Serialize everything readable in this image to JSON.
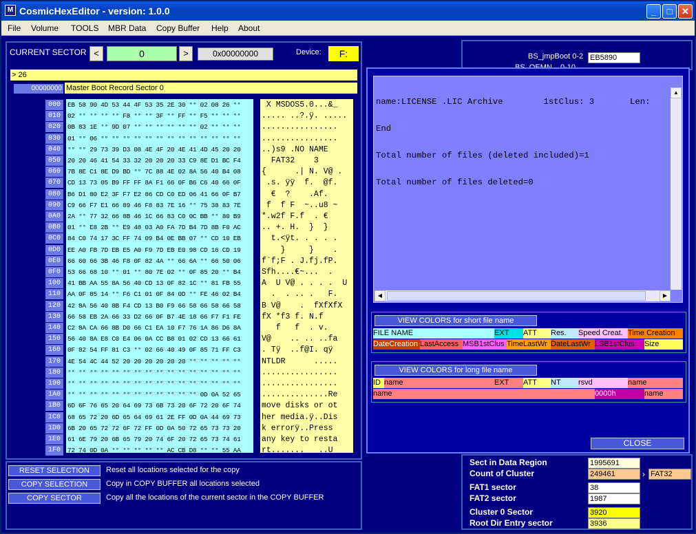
{
  "app": {
    "title": "CosmicHexEditor - version: 1.0.0",
    "icon_glyph": "M"
  },
  "menu": [
    "File",
    "Volume",
    "TOOLS",
    "MBR Data",
    "Copy Buffer",
    "Help",
    "About"
  ],
  "sector": {
    "label": "CURRENT SECTOR",
    "prev": "<",
    "next": ">",
    "value": "0",
    "hex": "0x00000000",
    "device_label": "Device:",
    "device": "F:"
  },
  "info": {
    "line": "> 26",
    "offset": "00000000",
    "desc": "Master Boot Record Sector 0"
  },
  "rows": [
    {
      "a": "000",
      "h": "EB 58 90 4D 53 44 4F 53 35 2E 30 °° 02 08 26 °°",
      "t": " X MSDOS5.0...&_"
    },
    {
      "a": "010",
      "h": "02 °° °° °° °° F8 °° °° 3F °° FF °° F5 °° °° °°",
      "t": "..... ..?.ÿ. ....."
    },
    {
      "a": "020",
      "h": "0B 83 1E °° 9D 07 °° °° °° °° °° °° 02 °° °° °°",
      "t": "................"
    },
    {
      "a": "030",
      "h": "01 °° 06 °° °° °° °° °° °° °° °° °° °° °° °° °°",
      "t": "................"
    },
    {
      "a": "040",
      "h": "°° °° 29 73 39 D3 08 4E 4F 20 4E 41 4D 45 20 20",
      "t": "..)s9 .NO NAME"
    },
    {
      "a": "050",
      "h": "20 20 46 41 54 33 32 20 20 20 33 C9 8E D1 BC F4",
      "t": "  FAT32    3"
    },
    {
      "a": "060",
      "h": "7B 8E C1 8E D9 BD °° 7C 88 4E 02 8A 56 40 B4 08",
      "t": "{      .| N. V@ ."
    },
    {
      "a": "070",
      "h": "CD 13 73 05 B9 FF FF 8A F1 66 0F B6 C6 40 66 0F",
      "t": " .s. ÿÿ  f.  @f."
    },
    {
      "a": "080",
      "h": "B6 D1 80 E2 3F F7 E2 86 CD C0 ED 06 41 66 0F B7",
      "t": "  €  ?    .Af."
    },
    {
      "a": "090",
      "h": "C9 66 F7 E1 66 89 46 F8 83 7E 16 °° 75 38 83 7E",
      "t": " f  f F  ~..u8 ~"
    },
    {
      "a": "0A0",
      "h": "2A °° 77 32 66 8B 46 1C 66 83 C0 0C BB °° 80 B9",
      "t": "*.w2f F.f  . €"
    },
    {
      "a": "0B0",
      "h": "01 °° E8 2B °° E9 48 03 A0 FA 7D B4 7D 8B F0 AC",
      "t": ".. +. H.  }  }"
    },
    {
      "a": "0C0",
      "h": "84 C0 74 17 3C FF 74 09 B4 0E BB 07 °° CD 10 EB",
      "t": "  t.<ÿt. . . . ."
    },
    {
      "a": "0D0",
      "h": "EE A0 FB 7D EB E5 A0 F9 7D EB E0 98 CD 16 CD 19",
      "t": "    }     }    ."
    },
    {
      "a": "0E0",
      "h": "66 60 66 3B 46 F8 0F 82 4A °° 66 6A °° 66 50 06",
      "t": "f`f;F . J.fj.fP."
    },
    {
      "a": "0F0",
      "h": "53 66 68 10 °° 01 °° 80 7E 02 °° 0F 85 20 °° B4",
      "t": "Sfh....€~...  ."
    },
    {
      "a": "100",
      "h": "41 BB AA 55 8A 56 40 CD 13 0F 82 1C °° 81 FB 55",
      "t": "A  U V@ . . . .  U"
    },
    {
      "a": "110",
      "h": "AA 0F 85 14 °° F6 C1 01 0F 84 0D °° FE 46 02 B4",
      "t": "  .  . .. .   F."
    },
    {
      "a": "120",
      "h": "42 8A 56 40 8B F4 CD 13 B0 F9 66 58 66 58 66 58",
      "t": "B V@    .  fXfXfX"
    },
    {
      "a": "130",
      "h": "66 58 EB 2A 66 33 D2 66 0F B7 4E 18 66 F7 F1 FE",
      "t": "fX *f3 f. N.f"
    },
    {
      "a": "140",
      "h": "C2 8A CA 66 8B D0 66 C1 EA 10 F7 76 1A 86 D6 8A",
      "t": "   f   f  . v."
    },
    {
      "a": "150",
      "h": "56 40 8A E8 C0 E4 06 0A CC B8 01 02 CD 13 66 61",
      "t": "V@    .. .. ..fa"
    },
    {
      "a": "160",
      "h": "0F 82 54 FF 81 C3 °° 02 66 40 49 0F 85 71 FF C3",
      "t": ". Tÿ  ..f@I. qÿ"
    },
    {
      "a": "170",
      "h": "4E 54 4C 44 52 20 20 20 20 20 20 °° °° °° °° °°",
      "t": "NTLDR      ....."
    },
    {
      "a": "180",
      "h": "°° °° °° °° °° °° °° °° °° °° °° °° °° °° °° °°",
      "t": "................"
    },
    {
      "a": "190",
      "h": "°° °° °° °° °° °° °° °° °° °° °° °° °° °° °° °°",
      "t": "................"
    },
    {
      "a": "1A0",
      "h": "°° °° °° °° °° °° °° °° °° °° °° °° 0D 0A 52 65",
      "t": "..............Re"
    },
    {
      "a": "1B0",
      "h": "6D 6F 76 65 20 64 69 73 6B 73 20 6F 72 20 6F 74",
      "t": "move disks or ot"
    },
    {
      "a": "1C0",
      "h": "68 65 72 20 6D 65 64 69 61 2E FF 0D 0A 44 69 73",
      "t": "her media.ÿ..Dis"
    },
    {
      "a": "1D0",
      "h": "6B 20 65 72 72 6F 72 FF 0D 0A 50 72 65 73 73 20",
      "t": "k errorÿ..Press "
    },
    {
      "a": "1E0",
      "h": "61 6E 79 20 6B 65 79 20 74 6F 20 72 65 73 74 61",
      "t": "any key to resta"
    },
    {
      "a": "1F0",
      "h": "72 74 0D 0A °° °° °° °° °° AC CB D8 °° °° 55 AA",
      "t": "rt.......   ..U"
    }
  ],
  "actions": [
    {
      "btn": "RESET SELECTION",
      "desc": "Reset all locations selected for the copy"
    },
    {
      "btn": "COPY SELECTION",
      "desc": "Copy in COPY BUFFER all locations selected"
    },
    {
      "btn": "COPY SECTOR",
      "desc": "Copy all the locations of the current sector in the COPY BUFFER"
    }
  ],
  "bs": {
    "l1": "BS_jmpBoot 0-2",
    "v1": "EB5890",
    "l2": "BS_OEMN... 0-10"
  },
  "dialog": {
    "lines": [
      "name:LICENSE .LIC Archive        1stClus: 3       Len:",
      "End",
      "Total number of files (deleted included)=1",
      "Total number of files deleted=0"
    ],
    "short_btn": "VIEW COLORS for short file name",
    "short_row1": [
      "FILE NAME",
      "EXT",
      "ATT",
      "Res.",
      "Speed Creat.",
      "Time Creation"
    ],
    "short_row2": [
      "DateCreation",
      "LastAccess",
      "MSB1stClus",
      "TimeLastWr",
      "DateLastWr",
      "LSB1stClus",
      "Size"
    ],
    "long_btn": "VIEW COLORS for long file name",
    "long_row1": [
      "ID",
      "name",
      "EXT",
      "ATT",
      "NT",
      "rsvd",
      "name"
    ],
    "long_row2": [
      "name",
      "0000h",
      "name"
    ],
    "close": "CLOSE"
  },
  "stats": [
    {
      "label": "Sect in Data Region",
      "value": "1995691"
    },
    {
      "label": "Count of Cluster",
      "value": "249461",
      "extra": "FAT32"
    },
    {
      "label": "FAT1 sector",
      "value": "38"
    },
    {
      "label": "FAT2 sector",
      "value": "1987"
    },
    {
      "label": "Cluster 0 Sector",
      "value": "3920"
    },
    {
      "label": "Root Dir Entry sector",
      "value": "3936"
    }
  ],
  "colors": {
    "hex_bg": "#aaffff",
    "ascii_bg": "#ffffaa",
    "dialog_text_bg": "#8080ff",
    "accent_yellow": "#ffff00"
  }
}
